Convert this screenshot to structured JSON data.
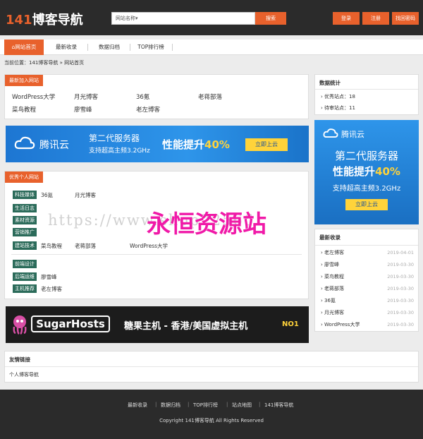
{
  "header": {
    "logo_num": "141",
    "logo_text": "博客导航",
    "search_placeholder": "网站名称",
    "search_button": "搜索",
    "buttons": [
      "登录",
      "注册",
      "找回密码"
    ]
  },
  "nav": {
    "items": [
      "网站首页",
      "最新收录",
      "数据归档",
      "TOP排行榜"
    ]
  },
  "breadcrumb": "当前位置：141博客导航 » 网站首页",
  "newest": {
    "title": "最新加入网站",
    "links": [
      "WordPress大学",
      "月光博客",
      "36氪",
      "老蒋部落",
      "菜鸟教程",
      "廖雪峰",
      "老左博客"
    ]
  },
  "stats": {
    "title": "数据统计",
    "lines": [
      "优秀站点：18",
      "待审站点：11"
    ]
  },
  "banner_tencent": {
    "brand": "腾讯云",
    "line1": "第二代服务器",
    "line2": "支持超高主频3.2GHz",
    "headline_a": "性能提升",
    "headline_b": "40%",
    "cta": "立即上云"
  },
  "side_ad": {
    "brand": "腾讯云",
    "line1": "第二代服务器",
    "headline_a": "性能提升",
    "headline_b": "40%",
    "line2": "支持超高主频3.2GHz",
    "cta": "立即上云"
  },
  "featured": {
    "title": "优秀个人网站",
    "rows": [
      {
        "tag": "科技媒体",
        "links": [
          "36氪",
          "月光博客"
        ]
      },
      {
        "tag": "生活日志",
        "links": []
      },
      {
        "tag": "素材资源",
        "links": []
      },
      {
        "tag": "营销推广",
        "links": []
      },
      {
        "tag": "建站技术",
        "links": [
          "菜鸟教程",
          "老蒋部落",
          "WordPress大学"
        ]
      },
      {
        "tag": "前端设计",
        "links": []
      },
      {
        "tag": "后端运维",
        "links": [
          "廖雪峰"
        ]
      },
      {
        "tag": "主机推荐",
        "links": [
          "老左博客"
        ]
      }
    ]
  },
  "latest": {
    "title": "最新收录",
    "items": [
      {
        "name": "老左博客",
        "date": "2019-04-01"
      },
      {
        "name": "廖雪峰",
        "date": "2019-03-30"
      },
      {
        "name": "菜鸟教程",
        "date": "2019-03-30"
      },
      {
        "name": "老蒋部落",
        "date": "2019-03-30"
      },
      {
        "name": "36氪",
        "date": "2019-03-30"
      },
      {
        "name": "月光博客",
        "date": "2019-03-30"
      },
      {
        "name": "WordPress大学",
        "date": "2019-03-30"
      }
    ]
  },
  "banner_sugar": {
    "brand": "SugarHosts",
    "slogan": "糖果主机 - 香港/美国虚拟主机",
    "badge": "NO1"
  },
  "friends": {
    "title": "友情链接",
    "links": [
      "个人博客导航"
    ]
  },
  "footer": {
    "links": [
      "最新收录",
      "数据归档",
      "TOP排行榜",
      "站点地图",
      "141博客导航"
    ],
    "copyright": "Copyright 141博客导航 All Rights Reserved"
  },
  "watermark": {
    "url": "https://www.shop22566.",
    "site": "永恒资源站"
  },
  "colors": {
    "accent": "#e8612c",
    "dark": "#2b2b2b",
    "tag": "#2b6b5a",
    "tencent_blue": "#1a73c9",
    "watermark": "#f01aa8"
  }
}
